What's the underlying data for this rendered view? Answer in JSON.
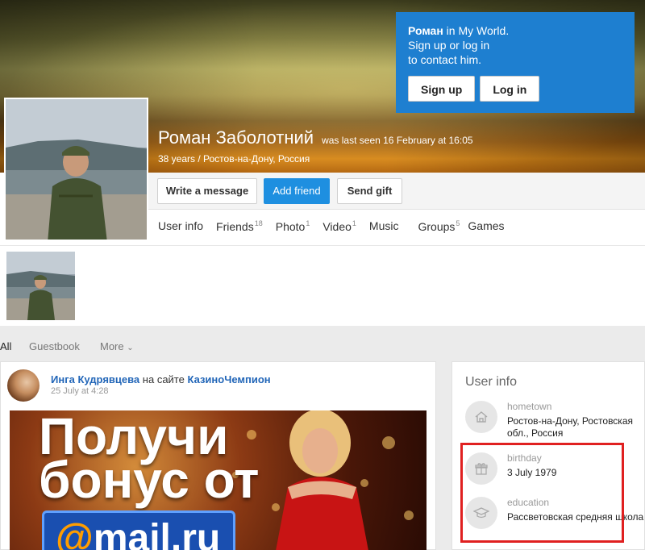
{
  "login_box": {
    "name": "Роман",
    "in_text": " in My World.",
    "line2": "Sign up or log in",
    "line3": "to contact him.",
    "signup_label": "Sign up",
    "login_label": "Log in"
  },
  "profile": {
    "name": "Роман Заболотний",
    "last_seen": "was last seen 16 February at 16:05",
    "subtitle": "38 years / Ростов-на-Дону, Россия"
  },
  "actions": {
    "write_message": "Write a message",
    "add_friend": "Add friend",
    "send_gift": "Send gift"
  },
  "tabs": [
    {
      "label": "User info",
      "count": ""
    },
    {
      "label": "Friends",
      "count": "18"
    },
    {
      "label": "Photo",
      "count": "1"
    },
    {
      "label": "Video",
      "count": "1"
    },
    {
      "label": "Music",
      "count": ""
    },
    {
      "label": "Groups",
      "count": "5"
    },
    {
      "label": "Games",
      "count": ""
    }
  ],
  "feed_filter": {
    "all": "All",
    "guestbook": "Guestbook",
    "more": "More"
  },
  "post": {
    "author": "Инга Кудрявцева",
    "on_site": "на сайте",
    "site": "КазиноЧемпион",
    "time": "25 July at 4:28",
    "banner_line1": "Получи",
    "banner_line2": "бонус от",
    "banner_brand_at": "@",
    "banner_brand": "mail.ru"
  },
  "user_info": {
    "title": "User info",
    "items": [
      {
        "label": "hometown",
        "value": "Ростов-на-Дону, Ростовская обл., Россия",
        "icon": "home-icon"
      },
      {
        "label": "birthday",
        "value": "3 July 1979",
        "icon": "gift-icon"
      },
      {
        "label": "education",
        "value": "Рассветовская средняя школа",
        "icon": "graduation-cap-icon"
      }
    ]
  },
  "colors": {
    "accent_blue": "#1e7fd0",
    "button_blue": "#1e8fe0",
    "link_blue": "#2266b8",
    "highlight_red": "#e02020"
  }
}
